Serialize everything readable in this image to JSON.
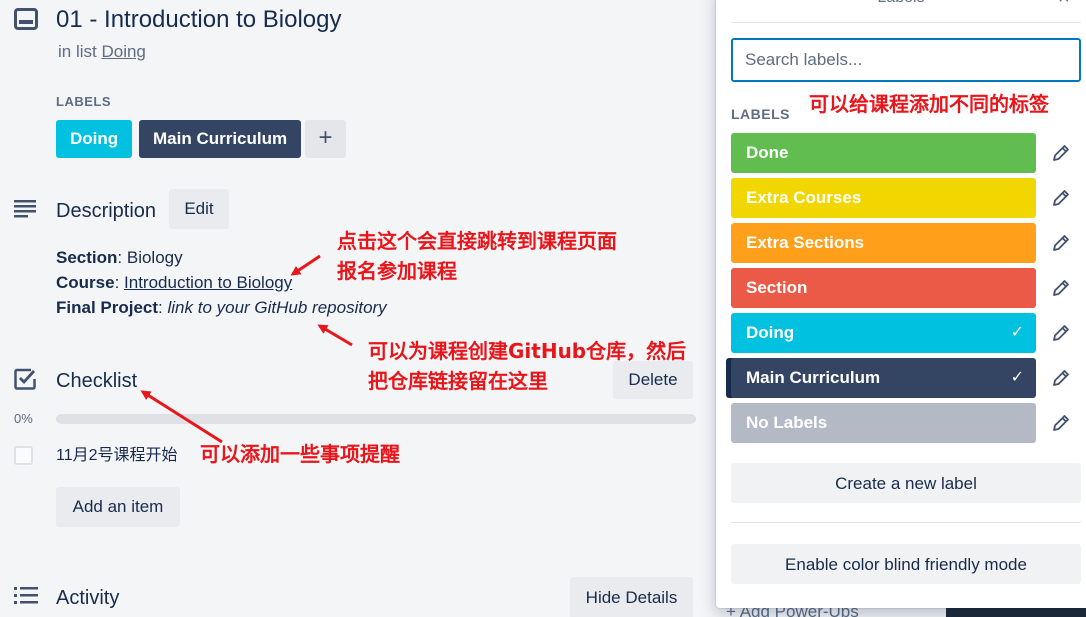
{
  "card": {
    "title": "01 - Introduction to Biology",
    "list_prefix": "in list",
    "list_name": "Doing"
  },
  "labels_section": {
    "heading": "LABELS",
    "chips": [
      {
        "name": "Doing",
        "color": "#00c2e0"
      },
      {
        "name": "Main Curriculum",
        "color": "#344563"
      }
    ],
    "add_symbol": "+"
  },
  "description": {
    "title": "Description",
    "edit_label": "Edit",
    "section_key": "Section",
    "section_value": ": Biology",
    "course_key": "Course",
    "course_sep": ": ",
    "course_link": "Introduction to Biology",
    "project_key": "Final Project",
    "project_sep": ": ",
    "project_value": "link to your GitHub repository"
  },
  "checklist": {
    "title": "Checklist",
    "delete_label": "Delete",
    "percent_text": "0%",
    "progress": 0,
    "items": [
      {
        "text": "11月2号课程开始",
        "checked": false
      }
    ],
    "add_item_label": "Add an item"
  },
  "activity": {
    "title": "Activity",
    "hide_details_label": "Hide Details"
  },
  "annotations": {
    "link_note_1": "点击这个会直接跳转到课程页面",
    "link_note_2": "报名参加课程",
    "github_note_1": "可以为课程创建GitHub仓库，然后",
    "github_note_2": "把仓库链接留在这里",
    "checklist_note": "可以添加一些事项提醒",
    "labels_note": "可以给课程添加不同的标签"
  },
  "popover": {
    "title": "Labels",
    "close_symbol": "×",
    "search_placeholder": "Search labels...",
    "labels_heading": "LABELS",
    "labels": [
      {
        "name": "Done",
        "color": "#61bd4f",
        "selected": false
      },
      {
        "name": "Extra Courses",
        "color": "#f2d600",
        "selected": false
      },
      {
        "name": "Extra Sections",
        "color": "#ff9f1a",
        "selected": false
      },
      {
        "name": "Section",
        "color": "#eb5a46",
        "selected": false
      },
      {
        "name": "Doing",
        "color": "#00c2e0",
        "selected": true
      },
      {
        "name": "Main Curriculum",
        "color": "#344563",
        "selected": true
      },
      {
        "name": "No Labels",
        "color": "#b3bac5",
        "selected": false
      }
    ],
    "check_symbol": "✓",
    "create_label": "Create a new label",
    "color_blind_label": "Enable color blind friendly mode",
    "behind_text": "+ Add Power-Ups"
  }
}
